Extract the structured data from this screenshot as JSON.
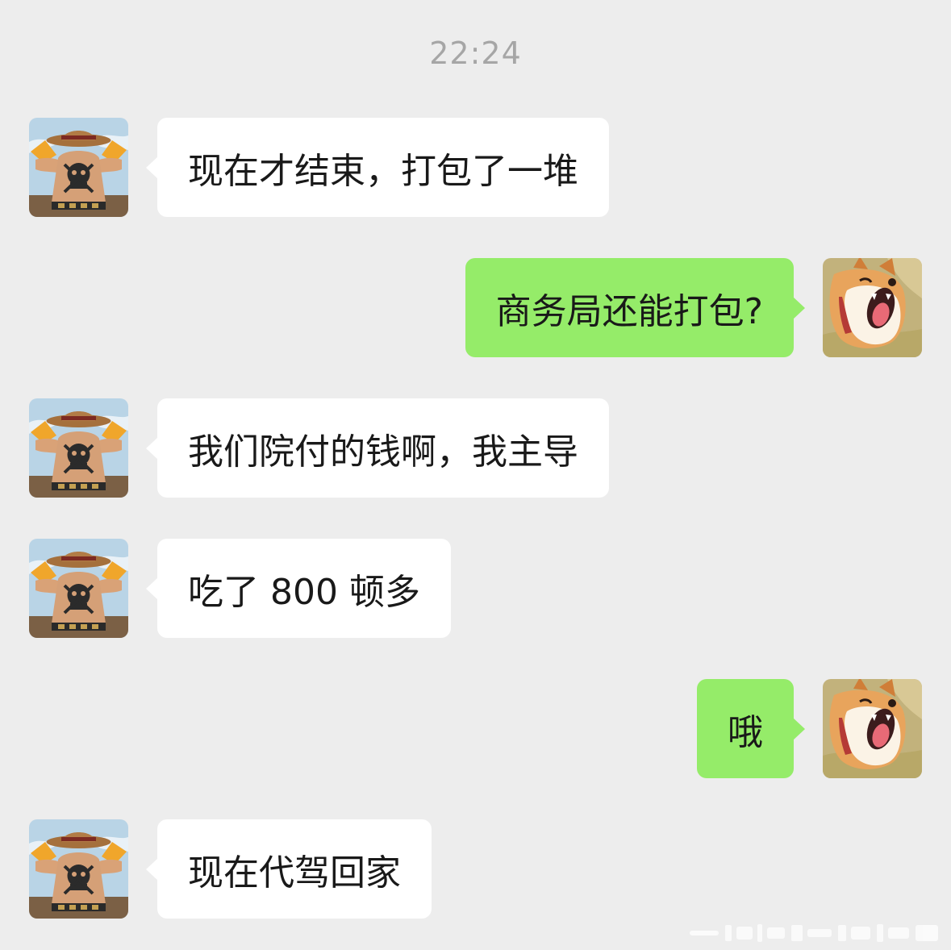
{
  "chat": {
    "timestamp": "22:24",
    "messages": [
      {
        "side": "left",
        "avatar": "pirate-back-tattoo-avatar",
        "text": "现在才结束，打包了一堆"
      },
      {
        "side": "right",
        "avatar": "shiba-dog-avatar",
        "text": "商务局还能打包?"
      },
      {
        "side": "left",
        "avatar": "pirate-back-tattoo-avatar",
        "text": "我们院付的钱啊，我主导"
      },
      {
        "side": "left",
        "avatar": "pirate-back-tattoo-avatar",
        "text": "吃了 800 顿多"
      },
      {
        "side": "right",
        "avatar": "shiba-dog-avatar",
        "text": "哦"
      },
      {
        "side": "left",
        "avatar": "pirate-back-tattoo-avatar",
        "text": "现在代驾回家"
      }
    ]
  },
  "colors": {
    "background": "#ededed",
    "incoming_bubble": "#ffffff",
    "outgoing_bubble": "#95ec69",
    "timestamp_text": "#a6a6a6"
  }
}
